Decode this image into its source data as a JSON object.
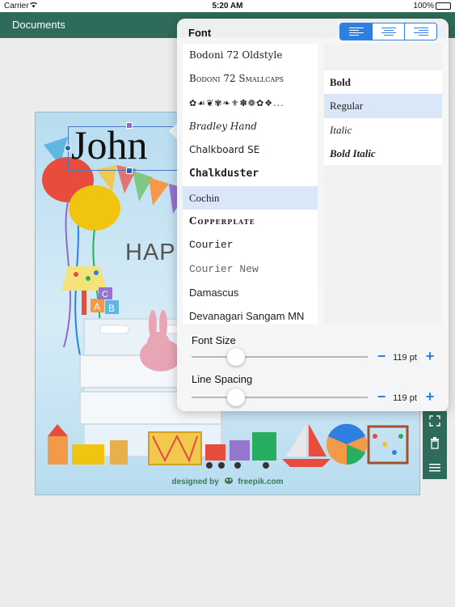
{
  "status_bar": {
    "carrier": "Carrier",
    "time": "5:20 AM",
    "battery": "100%"
  },
  "nav_bar": {
    "title": "Documents"
  },
  "card": {
    "name_text": "John",
    "banner_text": "HAP",
    "credit_prefix": "designed by",
    "credit_brand": "freepik.com"
  },
  "font_popover": {
    "title": "Font",
    "alignment_options": [
      "align-left",
      "align-center",
      "align-right"
    ],
    "selected_alignment": "align-left",
    "fonts": [
      "Bodoni 72 Oldstyle",
      "Bodoni 72 Smallcaps",
      "✿☙❦✾❧⚜✽❁✿❖...",
      "Bradley Hand",
      "Chalkboard SE",
      "Chalkduster",
      "Cochin",
      "Copperplate",
      "Courier",
      "Courier New",
      "Damascus",
      "Devanagari Sangam MN"
    ],
    "selected_font": "Cochin",
    "styles": [
      "Bold",
      "Regular",
      "Italic",
      "Bold Italic"
    ],
    "selected_style": "Regular",
    "font_size": {
      "label": "Font Size",
      "value": "119 pt",
      "slider_fraction": 0.25
    },
    "line_spacing": {
      "label": "Line Spacing",
      "value": "119 pt",
      "slider_fraction": 0.25
    }
  },
  "colors": {
    "nav_green": "#2f6b5a",
    "accent_blue": "#2d7fe0",
    "selected_row": "#d9e7f8"
  }
}
